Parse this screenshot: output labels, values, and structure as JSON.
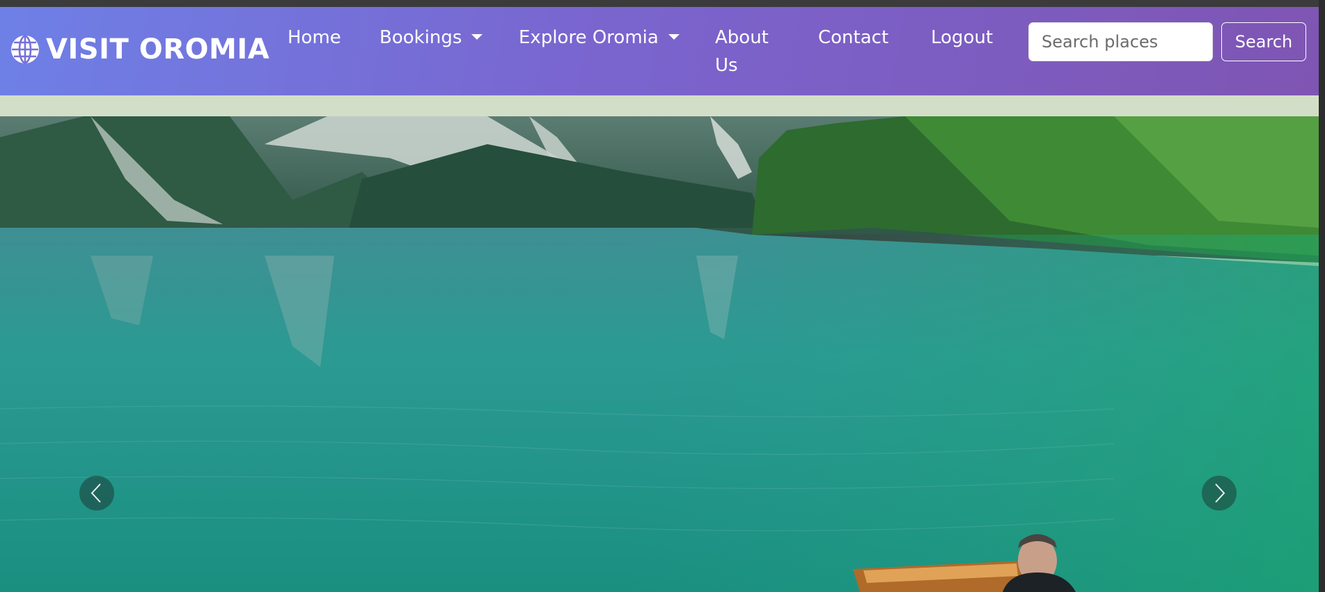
{
  "brand": {
    "name": "VISIT OROMIA",
    "icon": "globe-icon"
  },
  "nav": {
    "home": "Home",
    "bookings": "Bookings",
    "explore": "Explore Oromia",
    "about": "About Us",
    "contact": "Contact",
    "logout": "Logout"
  },
  "search": {
    "placeholder": "Search places",
    "button": "Search"
  },
  "hero": {
    "prev_icon": "chevron-left-icon",
    "next_icon": "chevron-right-icon"
  },
  "colors": {
    "nav_start": "#6e80e6",
    "nav_end": "#7f55b3",
    "band": "#d3dec9",
    "lake": "#1f9c8e"
  }
}
